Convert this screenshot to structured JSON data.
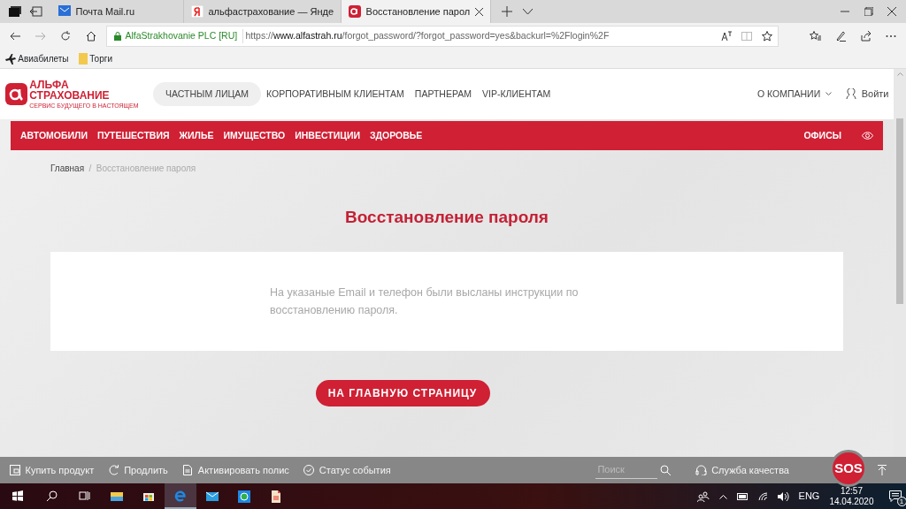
{
  "browser": {
    "tabs": [
      {
        "title": "Почта Mail.ru",
        "selected": false
      },
      {
        "title": "альфастрахование — Янде",
        "selected": false
      },
      {
        "title": "Восстановление парол",
        "selected": true
      }
    ],
    "address": {
      "site_identity": "AlfaStrakhovanie PLC [RU]",
      "url_scheme": "https://",
      "url_host": "www.alfastrah.ru",
      "url_rest": "/forgot_password/?forgot_password=yes&backurl=%2Flogin%2F"
    },
    "bookmarks": [
      "Авиабилеты",
      "Торги"
    ]
  },
  "site": {
    "logo": {
      "line_1": "АЛЬФА",
      "line_2": "СТРАХОВАНИЕ",
      "tagline": "СЕРВИС БУДУЩЕГО В НАСТОЯЩЕМ"
    },
    "top_nav": [
      {
        "label": "ЧАСТНЫМ ЛИЦАМ",
        "selected": true
      },
      {
        "label": "КОРПОРАТИВНЫМ КЛИЕНТАМ",
        "selected": false
      },
      {
        "label": "ПАРТНЕРАМ",
        "selected": false
      },
      {
        "label": "VIP-КЛИЕНТАМ",
        "selected": false
      }
    ],
    "company_menu": "О КОМПАНИИ",
    "login": "Войти",
    "category_nav": [
      "АВТОМОБИЛИ",
      "ПУТЕШЕСТВИЯ",
      "ЖИЛЬЕ",
      "ИМУЩЕСТВО",
      "ИНВЕСТИЦИИ",
      "ЗДОРОВЬЕ"
    ],
    "offices": "ОФИСЫ",
    "breadcrumb": [
      "Главная",
      "/",
      "Восстановление пароля"
    ],
    "title": "Восстановление пароля",
    "message": "На указаные Email и телефон были высланы инструкции по восстановлению пароля.",
    "button": "НА ГЛАВНУЮ СТРАНИЦУ",
    "bottom_bar": {
      "actions": [
        "Купить продукт",
        "Продлить",
        "Активировать полис",
        "Статус события"
      ],
      "search": {
        "placeholder": "Поиск"
      },
      "quality": "Служба качества",
      "sos": "SOS"
    }
  },
  "taskbar": {
    "apps": [
      {
        "selected": false
      },
      {
        "selected": false
      },
      {
        "selected": true
      },
      {
        "selected": false
      },
      {
        "selected": false
      },
      {
        "selected": false
      }
    ],
    "language": "ENG",
    "time": "12:57",
    "date": "14.04.2020",
    "notifications": "1"
  }
}
